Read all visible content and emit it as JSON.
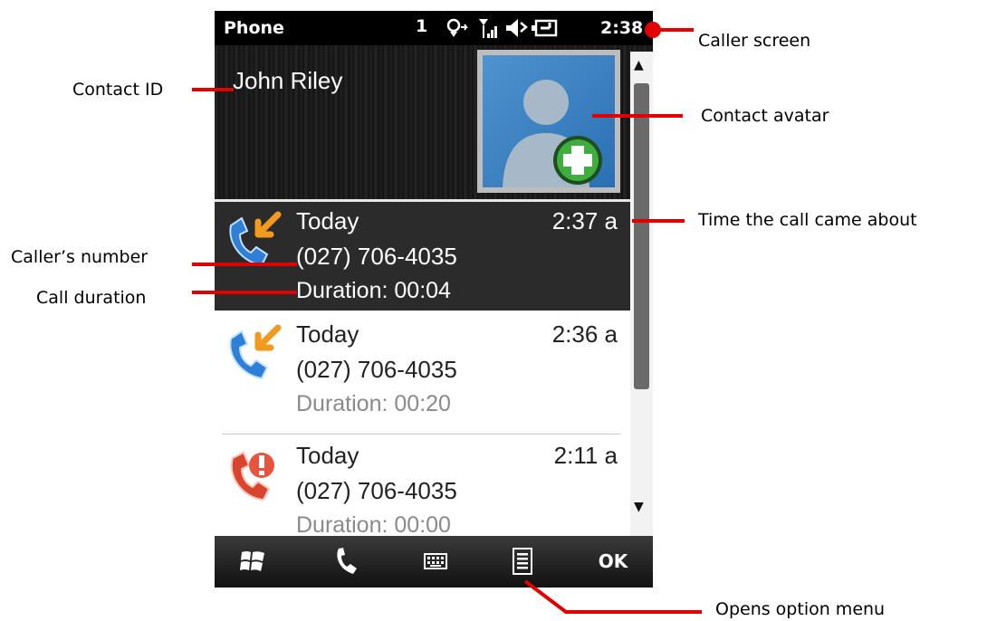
{
  "status_bar": {
    "app_title": "Phone",
    "status_number": "1",
    "clock": "2:38"
  },
  "contact": {
    "name": "John Riley"
  },
  "calls": [
    {
      "day": "Today",
      "time": "2:37 a",
      "number": "(027) 706-4035",
      "duration": "Duration: 00:04",
      "type": "incoming",
      "selected": true
    },
    {
      "day": "Today",
      "time": "2:36 a",
      "number": "(027) 706-4035",
      "duration": "Duration: 00:20",
      "type": "incoming",
      "selected": false
    },
    {
      "day": "Today",
      "time": "2:11 a",
      "number": "(027) 706-4035",
      "duration": "Duration: 00:00",
      "type": "missed",
      "selected": false
    }
  ],
  "softkeys": {
    "ok_label": "OK",
    "icons": [
      "windows-start-icon",
      "phone-icon",
      "keyboard-icon",
      "menu-icon"
    ]
  },
  "annotations": {
    "caller_screen": "Caller screen",
    "contact_id": "Contact ID",
    "contact_avatar": "Contact avatar",
    "time_call": "Time the call came about",
    "callers_number": "Caller’s number",
    "call_duration": "Call duration",
    "opens_option_menu": "Opens option menu"
  },
  "colors": {
    "annotation_line": "#e00000",
    "selected_row": "#2b2b2b",
    "incoming_icon": "#2f7fd6",
    "missed_icon": "#d9442f",
    "avatar_plus": "#3fae3f"
  }
}
